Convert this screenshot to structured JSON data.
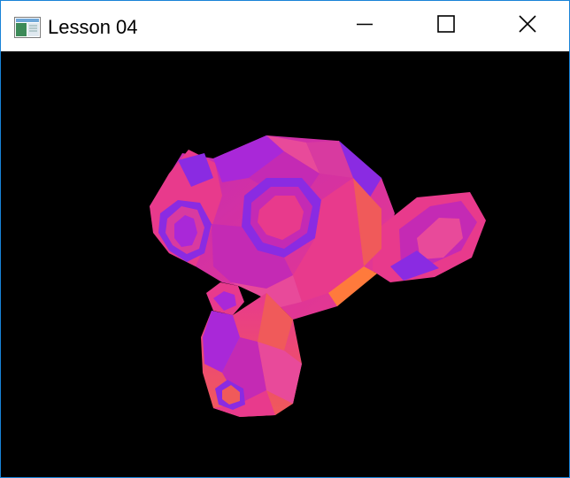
{
  "window": {
    "title": "Lesson 04",
    "app_icon": "application-window-icon",
    "controls": [
      {
        "name": "minimize",
        "icon": "minimize-icon"
      },
      {
        "name": "maximize",
        "icon": "maximize-icon"
      },
      {
        "name": "close",
        "icon": "close-icon"
      }
    ]
  },
  "viewport": {
    "background": "#000000",
    "model": "monkey-head-3d-model",
    "palette": [
      "#e83a8c",
      "#c42ab4",
      "#8a2be2",
      "#f05a5a",
      "#ff7a3c",
      "#a928d8"
    ]
  },
  "theme": {
    "accent_border": "#1883d7"
  }
}
